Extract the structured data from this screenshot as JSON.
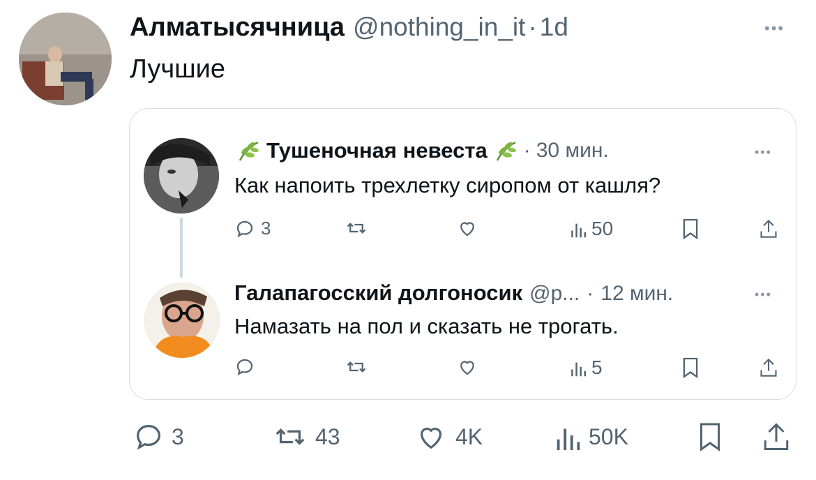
{
  "main_tweet": {
    "author_name": "Алматысячница",
    "author_handle": "@nothing_in_it",
    "separator": "·",
    "time": "1d",
    "text": "Лучшие",
    "actions": {
      "reply_count": "3",
      "retweet_count": "43",
      "like_count": "4K",
      "views_count": "50K"
    }
  },
  "quoted_thread": {
    "tweet1": {
      "author_name": "Тушеночная невеста",
      "separator": "·",
      "time": "30 мин.",
      "text": "Как напоить трехлетку сиропом от кашля?",
      "actions": {
        "reply_count": "3",
        "views_count": "50"
      }
    },
    "tweet2": {
      "author_name": "Галапагосский долгоносик",
      "author_handle": "@p...",
      "separator": "·",
      "time": "12 мин.",
      "text": "Намазать на пол и сказать не трогать.",
      "actions": {
        "views_count": "5"
      }
    }
  },
  "more_glyph": "•••",
  "colors": {
    "text": "#0f1419",
    "muted": "#536471",
    "border": "#d6dde2",
    "leaf": "#6aa84f"
  }
}
